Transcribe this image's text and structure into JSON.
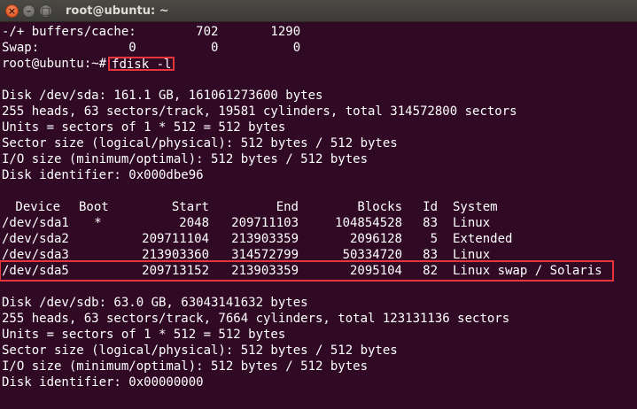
{
  "window": {
    "title": "root@ubuntu: ~",
    "close_glyph": "×",
    "min_glyph": "–",
    "max_glyph": "□"
  },
  "terminal": {
    "pre_lines": [
      "-/+ buffers/cache:        702       1290",
      "Swap:            0          0          0"
    ],
    "prompt": "root@ubuntu:~#",
    "command": "fdisk -l",
    "sda_info": [
      "Disk /dev/sda: 161.1 GB, 161061273600 bytes",
      "255 heads, 63 sectors/track, 19581 cylinders, total 314572800 sectors",
      "Units = sectors of 1 * 512 = 512 bytes",
      "Sector size (logical/physical): 512 bytes / 512 bytes",
      "I/O size (minimum/optimal): 512 bytes / 512 bytes",
      "Disk identifier: 0x000dbe96"
    ],
    "table_header": {
      "device": "Device",
      "boot": "Boot",
      "start": "Start",
      "end": "End",
      "blocks": "Blocks",
      "id": "Id",
      "system": "System"
    },
    "partitions": [
      {
        "device": "/dev/sda1",
        "boot": "*",
        "start": "2048",
        "end": "209711103",
        "blocks": "104854528",
        "id": "83",
        "system": "Linux"
      },
      {
        "device": "/dev/sda2",
        "boot": "",
        "start": "209711104",
        "end": "213903359",
        "blocks": "2096128",
        "id": "5",
        "system": "Extended"
      },
      {
        "device": "/dev/sda3",
        "boot": "",
        "start": "213903360",
        "end": "314572799",
        "blocks": "50334720",
        "id": "83",
        "system": "Linux"
      },
      {
        "device": "/dev/sda5",
        "boot": "",
        "start": "209713152",
        "end": "213903359",
        "blocks": "2095104",
        "id": "82",
        "system": "Linux swap / Solaris"
      }
    ],
    "sdb_info": [
      "Disk /dev/sdb: 63.0 GB, 63043141632 bytes",
      "255 heads, 63 sectors/track, 7664 cylinders, total 123131136 sectors",
      "Units = sectors of 1 * 512 = 512 bytes",
      "Sector size (logical/physical): 512 bytes / 512 bytes",
      "I/O size (minimum/optimal): 512 bytes / 512 bytes",
      "Disk identifier: 0x00000000"
    ]
  },
  "colors": {
    "background": "#300a24",
    "text": "#ffffff",
    "highlight": "#e8343a"
  }
}
